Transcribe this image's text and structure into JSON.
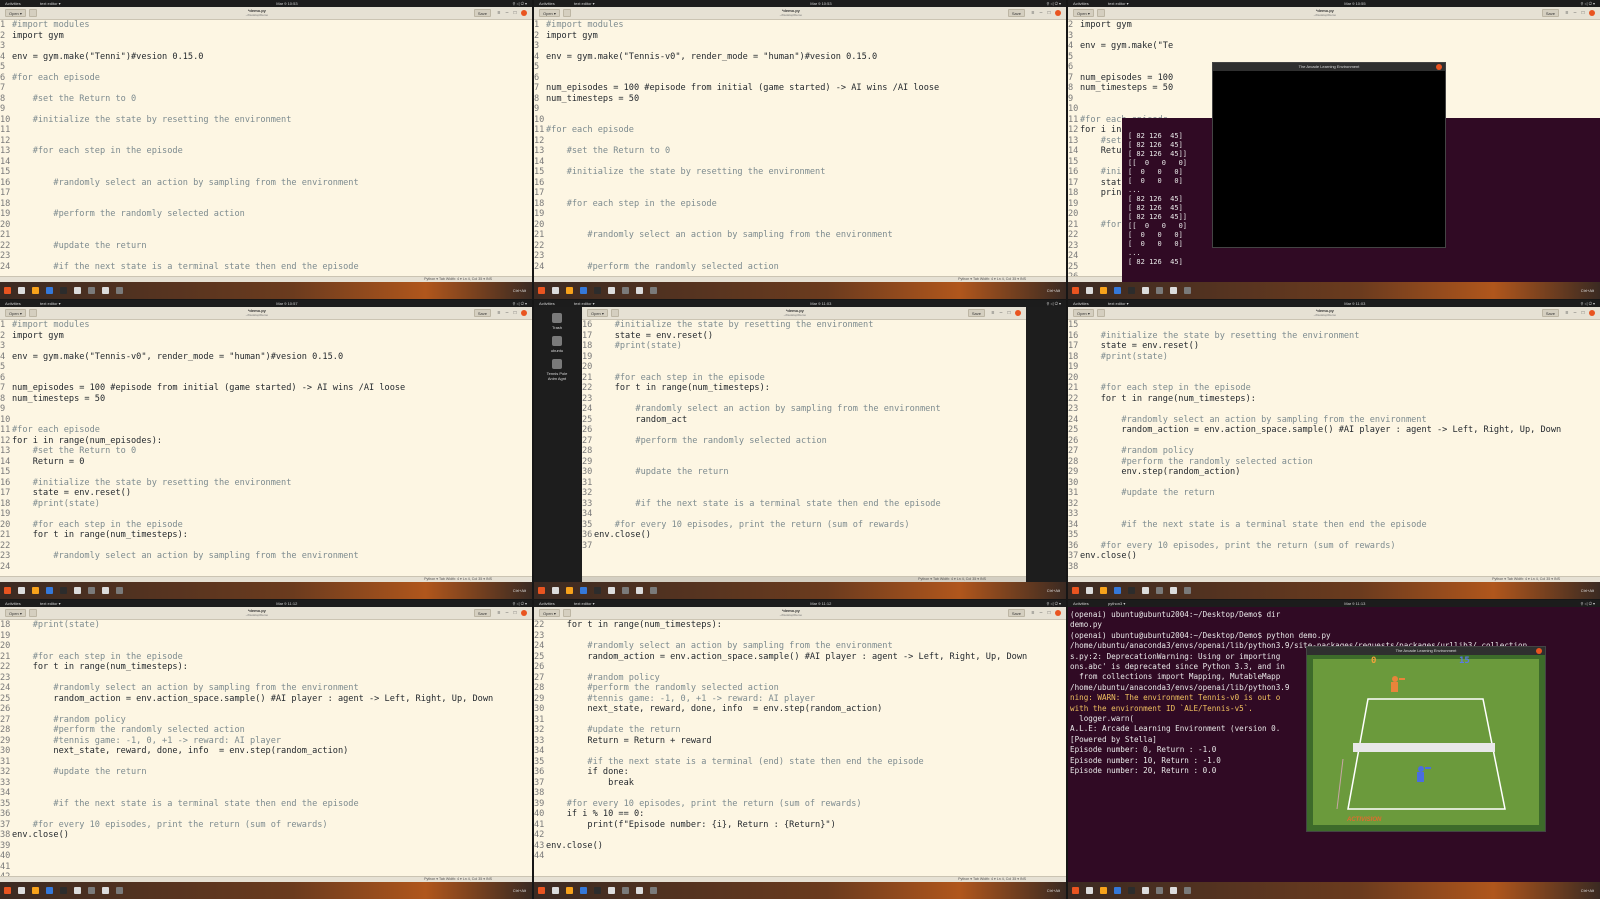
{
  "system": {
    "activities": "Activities",
    "app_gedit": "text editor ▾",
    "app_python": "python3 ▾",
    "tray": "⚲ ◁ ⏻ ▾"
  },
  "gedit": {
    "open_label": "Open ▾",
    "save_label": "Save",
    "file_name": "*demo.py",
    "file_path": "~/Desktop/Demo",
    "status_lang": "Python ▾",
    "status_tab": "Tab Width: 4 ▾",
    "status_pos": "Ln 4, Col 35 ▾",
    "status_ins": "INS"
  },
  "dock": {
    "ctlabel": "Ctrl+Alt"
  },
  "cells": [
    {
      "clock": "Mar 9 10:53",
      "lines": [
        [
          "1",
          "#import modules"
        ],
        [
          "2",
          "import gym"
        ],
        [
          "3",
          ""
        ],
        [
          "4",
          "env = gym.make(\"Tenni\")#vesion 0.15.0"
        ],
        [
          "5",
          ""
        ],
        [
          "6",
          "#for each episode"
        ],
        [
          "7",
          ""
        ],
        [
          "8",
          "    #set the Return to 0"
        ],
        [
          "9",
          ""
        ],
        [
          "10",
          "    #initialize the state by resetting the environment"
        ],
        [
          "11",
          ""
        ],
        [
          "12",
          ""
        ],
        [
          "13",
          "    #for each step in the episode"
        ],
        [
          "14",
          ""
        ],
        [
          "15",
          ""
        ],
        [
          "16",
          "        #randomly select an action by sampling from the environment"
        ],
        [
          "17",
          ""
        ],
        [
          "18",
          ""
        ],
        [
          "19",
          "        #perform the randomly selected action"
        ],
        [
          "20",
          ""
        ],
        [
          "21",
          ""
        ],
        [
          "22",
          "        #update the return"
        ],
        [
          "23",
          ""
        ],
        [
          "24",
          "        #if the next state is a terminal state then end the episode"
        ]
      ]
    },
    {
      "clock": "Mar 9 10:53",
      "lines": [
        [
          "1",
          "#import modules"
        ],
        [
          "2",
          "import gym"
        ],
        [
          "3",
          ""
        ],
        [
          "4",
          "env = gym.make(\"Tennis-v0\", render_mode = \"human\")#vesion 0.15.0"
        ],
        [
          "5",
          ""
        ],
        [
          "6",
          ""
        ],
        [
          "7",
          "num_episodes = 100 #episode from initial (game started) -> AI wins /AI loose"
        ],
        [
          "8",
          "num_timesteps = 50"
        ],
        [
          "9",
          ""
        ],
        [
          "10",
          ""
        ],
        [
          "11",
          "#for each episode"
        ],
        [
          "12",
          ""
        ],
        [
          "13",
          "    #set the Return to 0"
        ],
        [
          "14",
          ""
        ],
        [
          "15",
          "    #initialize the state by resetting the environment"
        ],
        [
          "16",
          ""
        ],
        [
          "17",
          ""
        ],
        [
          "18",
          "    #for each step in the episode"
        ],
        [
          "19",
          ""
        ],
        [
          "20",
          ""
        ],
        [
          "21",
          "        #randomly select an action by sampling from the environment"
        ],
        [
          "22",
          ""
        ],
        [
          "23",
          ""
        ],
        [
          "24",
          "        #perform the randomly selected action"
        ]
      ]
    },
    {
      "clock": "Mar 9 10:55",
      "lines": [
        [
          "2",
          "import gym"
        ],
        [
          "3",
          ""
        ],
        [
          "4",
          "env = gym.make(\"Te"
        ],
        [
          "5",
          ""
        ],
        [
          "6",
          ""
        ],
        [
          "7",
          "num_episodes = 100"
        ],
        [
          "8",
          "num_timesteps = 50"
        ],
        [
          "9",
          ""
        ],
        [
          "10",
          ""
        ],
        [
          "11",
          "#for each episode"
        ],
        [
          "12",
          "for i in"
        ],
        [
          "13",
          "    #set"
        ],
        [
          "14",
          "    Retu"
        ],
        [
          "15",
          ""
        ],
        [
          "16",
          "    #ini"
        ],
        [
          "17",
          "    stat"
        ],
        [
          "18",
          "    prin"
        ],
        [
          "19",
          ""
        ],
        [
          "20",
          ""
        ],
        [
          "21",
          "    #for"
        ],
        [
          "22",
          ""
        ],
        [
          "23",
          ""
        ],
        [
          "24",
          ""
        ],
        [
          "25",
          ""
        ],
        [
          "26",
          ""
        ]
      ],
      "term_lines": [
        "[ 82 126  45]",
        "[ 82 126  45]",
        "[ 82 126  45]]",
        "",
        "[[  0   0   0]",
        "[  0   0   0]",
        "[  0   0   0]",
        "...",
        "[ 82 126  45]",
        "[ 82 126  45]",
        "[ 82 126  45]]",
        "",
        "[[  0   0   0]",
        "[  0   0   0]",
        "[  0   0   0]",
        "...",
        "[ 82 126  45]"
      ],
      "ale_title": "The Arcade Learning Environment"
    },
    {
      "clock": "Mar 9 10:57",
      "lines": [
        [
          "1",
          "#import modules"
        ],
        [
          "2",
          "import gym"
        ],
        [
          "3",
          ""
        ],
        [
          "4",
          "env = gym.make(\"Tennis-v0\", render_mode = \"human\")#vesion 0.15.0"
        ],
        [
          "5",
          ""
        ],
        [
          "6",
          ""
        ],
        [
          "7",
          "num_episodes = 100 #episode from initial (game started) -> AI wins /AI loose"
        ],
        [
          "8",
          "num_timesteps = 50"
        ],
        [
          "9",
          ""
        ],
        [
          "10",
          ""
        ],
        [
          "11",
          "#for each episode"
        ],
        [
          "12",
          "for i in range(num_episodes):"
        ],
        [
          "13",
          "    #set the Return to 0"
        ],
        [
          "14",
          "    Return = 0"
        ],
        [
          "15",
          ""
        ],
        [
          "16",
          "    #initialize the state by resetting the environment"
        ],
        [
          "17",
          "    state = env.reset()"
        ],
        [
          "18",
          "    #print(state)"
        ],
        [
          "19",
          ""
        ],
        [
          "20",
          "    #for each step in the episode"
        ],
        [
          "21",
          "    for t in range(num_timesteps):"
        ],
        [
          "22",
          ""
        ],
        [
          "23",
          "        #randomly select an action by sampling from the environment"
        ],
        [
          "24",
          ""
        ]
      ]
    },
    {
      "clock": "Mar 9 11:03",
      "lines": [
        [
          "16",
          "    #initialize the state by resetting the environment"
        ],
        [
          "17",
          "    state = env.reset()"
        ],
        [
          "18",
          "    #print(state)"
        ],
        [
          "19",
          ""
        ],
        [
          "20",
          ""
        ],
        [
          "21",
          "    #for each step in the episode"
        ],
        [
          "22",
          "    for t in range(num_timesteps):"
        ],
        [
          "23",
          ""
        ],
        [
          "24",
          "        #randomly select an action by sampling from the environment"
        ],
        [
          "25",
          "        random_act"
        ],
        [
          "26",
          ""
        ],
        [
          "27",
          "        #perform the randomly selected action"
        ],
        [
          "28",
          ""
        ],
        [
          "29",
          ""
        ],
        [
          "30",
          "        #update the return"
        ],
        [
          "31",
          ""
        ],
        [
          "32",
          ""
        ],
        [
          "33",
          "        #if the next state is a terminal state then end the episode"
        ],
        [
          "34",
          ""
        ],
        [
          "35",
          "    #for every 10 episodes, print the return (sum of rewards)"
        ],
        [
          "36",
          "env.close()"
        ],
        [
          "37",
          ""
        ]
      ],
      "desktop_icons": [
        "Trash",
        "ubuntu",
        "Tennis Pole Anim Agnt"
      ]
    },
    {
      "clock": "Mar 9 11:03",
      "lines": [
        [
          "15",
          ""
        ],
        [
          "16",
          "    #initialize the state by resetting the environment"
        ],
        [
          "17",
          "    state = env.reset()"
        ],
        [
          "18",
          "    #print(state)"
        ],
        [
          "19",
          ""
        ],
        [
          "20",
          ""
        ],
        [
          "21",
          "    #for each step in the episode"
        ],
        [
          "22",
          "    for t in range(num_timesteps):"
        ],
        [
          "23",
          ""
        ],
        [
          "24",
          "        #randomly select an action by sampling from the environment"
        ],
        [
          "25",
          "        random_action = env.action_space.sample() #AI player : agent -> Left, Right, Up, Down"
        ],
        [
          "26",
          ""
        ],
        [
          "27",
          "        #random policy"
        ],
        [
          "28",
          "        #perform the randomly selected action"
        ],
        [
          "29",
          "        env.step(random_action)"
        ],
        [
          "30",
          ""
        ],
        [
          "31",
          "        #update the return"
        ],
        [
          "32",
          ""
        ],
        [
          "33",
          ""
        ],
        [
          "34",
          "        #if the next state is a terminal state then end the episode"
        ],
        [
          "35",
          ""
        ],
        [
          "36",
          "    #for every 10 episodes, print the return (sum of rewards)"
        ],
        [
          "37",
          "env.close()"
        ],
        [
          "38",
          ""
        ]
      ]
    },
    {
      "clock": "Mar 9 11:12",
      "lines": [
        [
          "18",
          "    #print(state)"
        ],
        [
          "19",
          ""
        ],
        [
          "20",
          ""
        ],
        [
          "21",
          "    #for each step in the episode"
        ],
        [
          "22",
          "    for t in range(num_timesteps):"
        ],
        [
          "23",
          ""
        ],
        [
          "24",
          "        #randomly select an action by sampling from the environment"
        ],
        [
          "25",
          "        random_action = env.action_space.sample() #AI player : agent -> Left, Right, Up, Down"
        ],
        [
          "26",
          ""
        ],
        [
          "27",
          "        #random policy"
        ],
        [
          "28",
          "        #perform the randomly selected action"
        ],
        [
          "29",
          "        #tennis game: -1, 0, +1 -> reward: AI player"
        ],
        [
          "30",
          "        next_state, reward, done, info  = env.step(random_action)"
        ],
        [
          "31",
          ""
        ],
        [
          "32",
          "        #update the return"
        ],
        [
          "33",
          ""
        ],
        [
          "34",
          ""
        ],
        [
          "35",
          "        #if the next state is a terminal state then end the episode"
        ],
        [
          "36",
          ""
        ],
        [
          "37",
          "    #for every 10 episodes, print the return (sum of rewards)"
        ],
        [
          "38",
          "env.close()"
        ],
        [
          "39",
          ""
        ],
        [
          "40",
          ""
        ],
        [
          "41",
          ""
        ],
        [
          "42",
          ""
        ]
      ]
    },
    {
      "clock": "Mar 9 11:12",
      "lines": [
        [
          "22",
          "    for t in range(num_timesteps):"
        ],
        [
          "23",
          ""
        ],
        [
          "24",
          "        #randomly select an action by sampling from the environment"
        ],
        [
          "25",
          "        random_action = env.action_space.sample() #AI player : agent -> Left, Right, Up, Down"
        ],
        [
          "26",
          ""
        ],
        [
          "27",
          "        #random policy"
        ],
        [
          "28",
          "        #perform the randomly selected action"
        ],
        [
          "29",
          "        #tennis game: -1, 0, +1 -> reward: AI player"
        ],
        [
          "30",
          "        next_state, reward, done, info  = env.step(random_action)"
        ],
        [
          "31",
          ""
        ],
        [
          "32",
          "        #update the return"
        ],
        [
          "33",
          "        Return = Return + reward"
        ],
        [
          "34",
          ""
        ],
        [
          "35",
          "        #if the next state is a terminal (end) state then end the episode"
        ],
        [
          "36",
          "        if done:"
        ],
        [
          "37",
          "            break"
        ],
        [
          "38",
          ""
        ],
        [
          "39",
          "    #for every 10 episodes, print the return (sum of rewards)"
        ],
        [
          "40",
          "    if i % 10 == 0:"
        ],
        [
          "41",
          "        print(f\"Episode number: {i}, Return : {Return}\")"
        ],
        [
          "42",
          ""
        ],
        [
          "43",
          "env.close()"
        ],
        [
          "44",
          ""
        ]
      ]
    },
    {
      "clock": "Mar 9 11:13",
      "term_lines": [
        "(openai) ubuntu@ubuntu2004:~/Desktop/Demo$ dir",
        "demo.py",
        "(openai) ubuntu@ubuntu2004:~/Desktop/Demo$ python demo.py",
        "/home/ubuntu/anaconda3/envs/openai/lib/python3.9/site-packages/requests/packages/urllib3/_collection",
        "s.py:2: DeprecationWarning: Using or importing",
        "ons.abc' is deprecated since Python 3.3, and in",
        "  from collections import Mapping, MutableMapp",
        "/home/ubuntu/anaconda3/envs/openai/lib/python3.9",
        "ning: WARN: The environment Tennis-v0 is out o",
        "with the environment ID `ALE/Tennis-v5`.",
        "  logger.warn(",
        "A.L.E: Arcade Learning Environment (version 0.",
        "[Powered by Stella]",
        "Episode number: 0, Return : -1.0",
        "Episode number: 10, Return : -1.0",
        "Episode number: 20, Return : 0.0"
      ],
      "ale_title": "The Arcade Learning Environment",
      "score_left": "0",
      "score_right": "15",
      "brand": "ACTIVISION"
    }
  ]
}
